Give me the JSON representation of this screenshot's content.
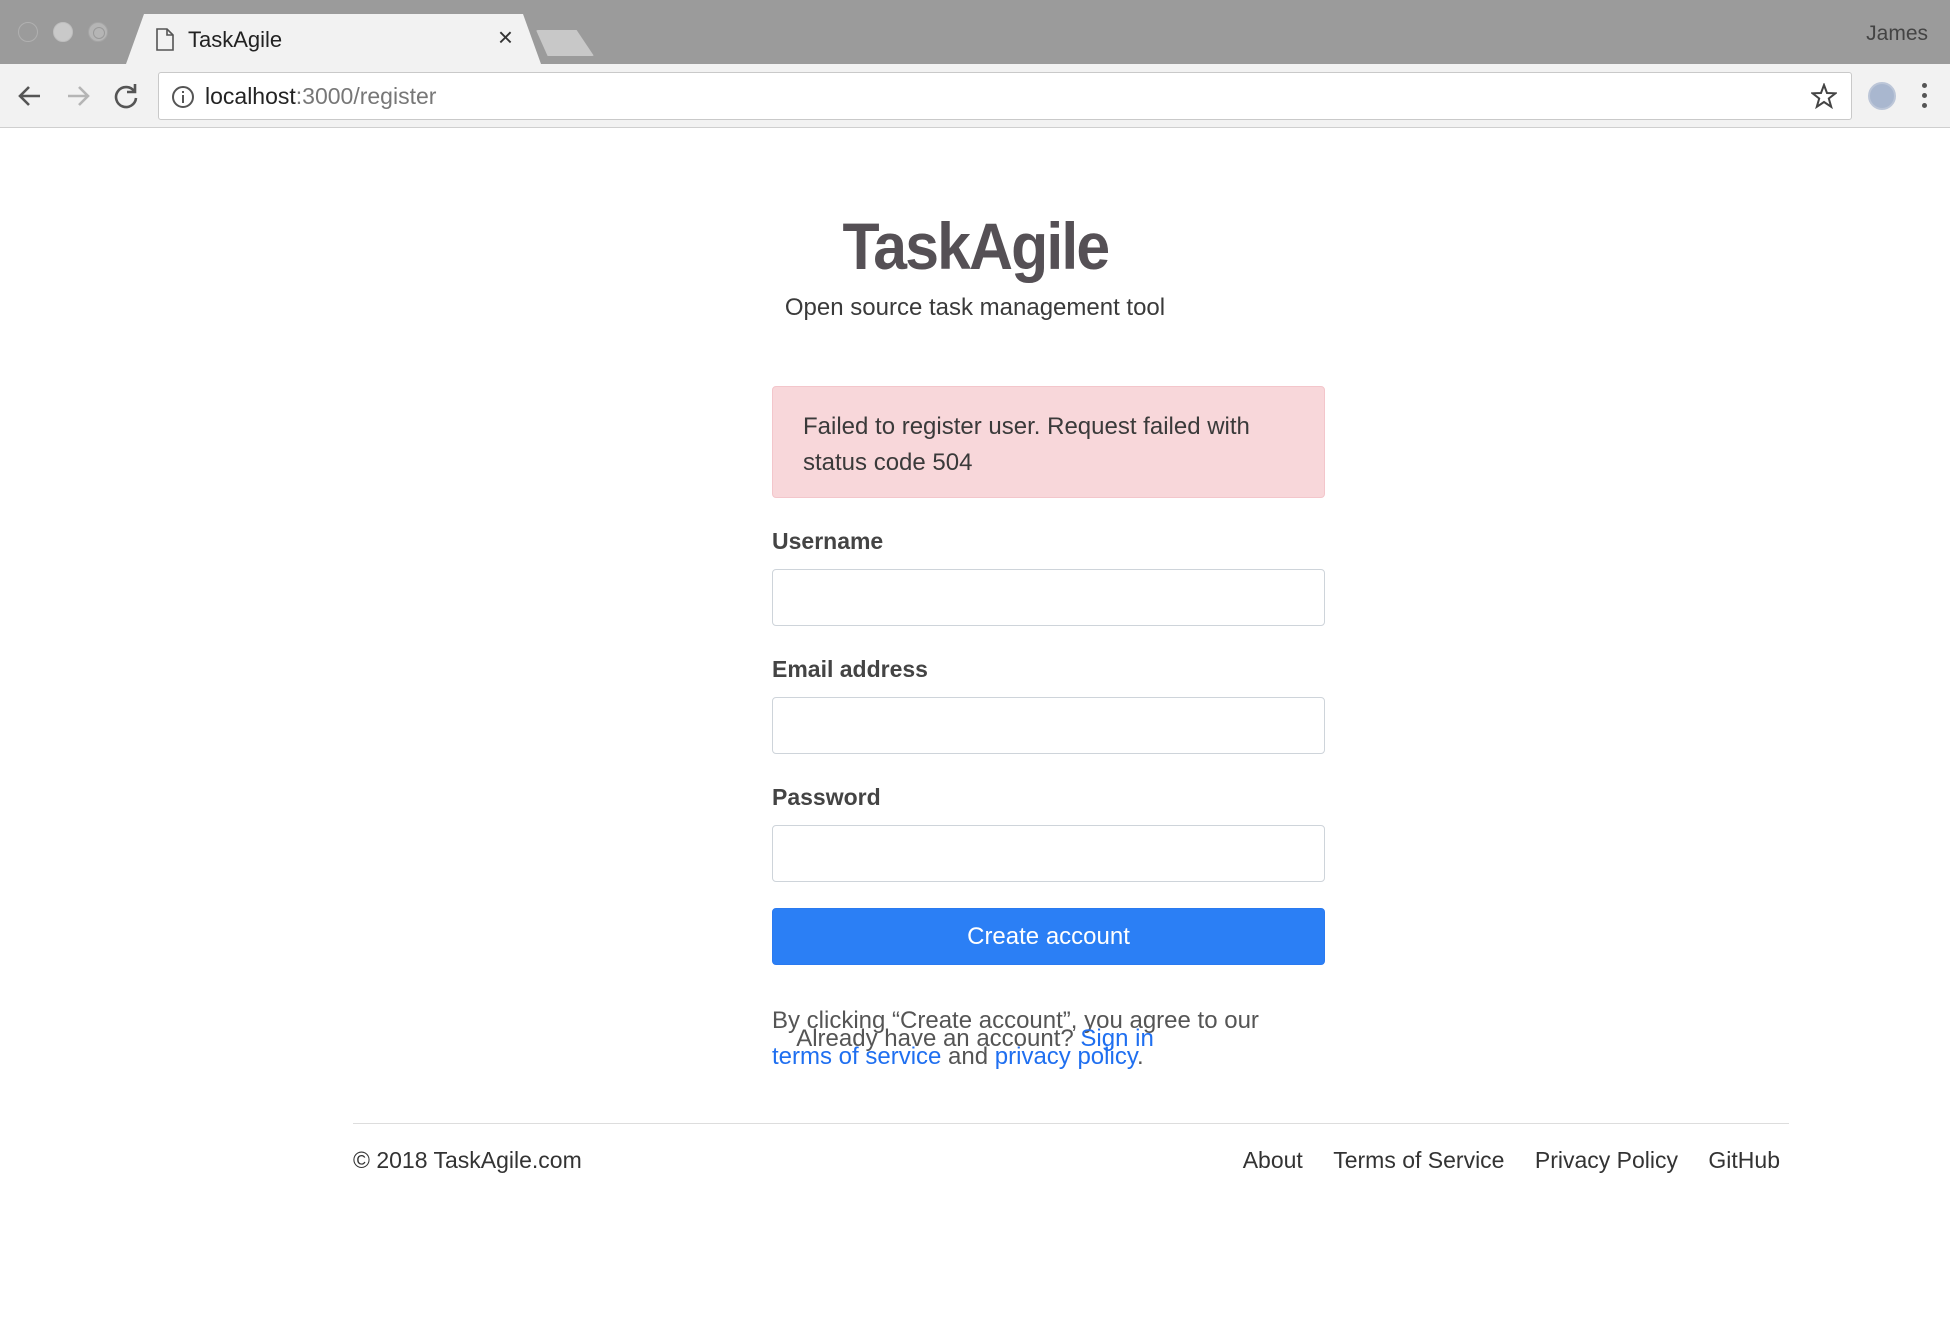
{
  "browser": {
    "tab_title": "TaskAgile",
    "tab_close": "×",
    "profile_name": "James",
    "url_host": "localhost",
    "url_path": ":3000/register"
  },
  "brand": {
    "logo": "TaskAgile",
    "tagline": "Open source task management tool"
  },
  "form": {
    "error_message": "Failed to register user. Request failed with status code 504",
    "username_label": "Username",
    "username_value": "",
    "email_label": "Email address",
    "email_value": "",
    "password_label": "Password",
    "password_value": "",
    "submit_label": "Create account",
    "agree_prefix": "By clicking “Create account”, you agree to our ",
    "terms_link": "terms of service",
    "agree_and": " and ",
    "privacy_link": "privacy policy",
    "agree_suffix": "."
  },
  "signin": {
    "prompt": "Already have an account? ",
    "link": "Sign in"
  },
  "footer": {
    "copyright": "© 2018 TaskAgile.com",
    "links": [
      "About",
      "Terms of Service",
      "Privacy Policy",
      "GitHub"
    ]
  },
  "colors": {
    "primary": "#2b7ff5",
    "link": "#1f6ff0",
    "alert_bg": "#f8d7da"
  }
}
